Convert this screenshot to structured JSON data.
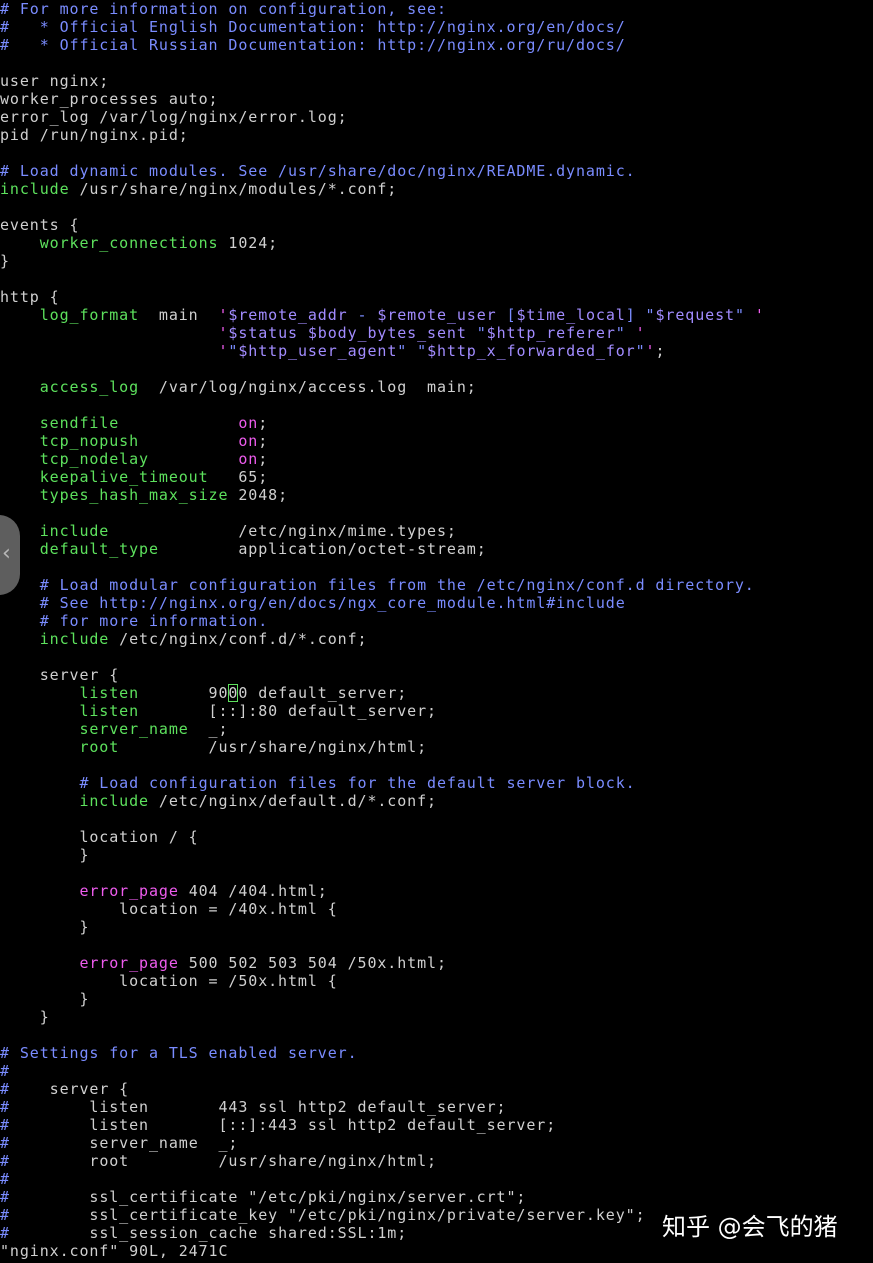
{
  "editor": {
    "lines": [
      [
        {
          "t": "# For more information on configuration, see:",
          "s": "comment"
        }
      ],
      [
        {
          "t": "#   * Official English Documentation: http://nginx.org/en/docs/",
          "s": "comment"
        }
      ],
      [
        {
          "t": "#   * Official Russian Documentation: http://nginx.org/ru/docs/",
          "s": "comment"
        }
      ],
      [],
      [
        {
          "t": "user nginx;",
          "s": "plain"
        }
      ],
      [
        {
          "t": "worker_processes auto;",
          "s": "plain"
        }
      ],
      [
        {
          "t": "error_log /var/log/nginx/error.log;",
          "s": "plain"
        }
      ],
      [
        {
          "t": "pid /run/nginx.pid;",
          "s": "plain"
        }
      ],
      [],
      [
        {
          "t": "# Load dynamic modules. See /usr/share/doc/nginx/README.dynamic.",
          "s": "comment"
        }
      ],
      [
        {
          "t": "include",
          "s": "keyword"
        },
        {
          "t": " /usr/share/nginx/modules/*.conf;",
          "s": "plain"
        }
      ],
      [],
      [
        {
          "t": "events {",
          "s": "plain"
        }
      ],
      [
        {
          "t": "    worker_connections",
          "s": "keyword"
        },
        {
          "t": " 1024;",
          "s": "plain"
        }
      ],
      [
        {
          "t": "}",
          "s": "plain"
        }
      ],
      [],
      [
        {
          "t": "http {",
          "s": "plain"
        }
      ],
      [
        {
          "t": "    log_format",
          "s": "keyword"
        },
        {
          "t": "  main  ",
          "s": "plain"
        },
        {
          "t": "'",
          "s": "value"
        },
        {
          "t": "$remote_addr",
          "s": "var"
        },
        {
          "t": " - ",
          "s": "string"
        },
        {
          "t": "$remote_user",
          "s": "var"
        },
        {
          "t": " [",
          "s": "string"
        },
        {
          "t": "$time_local",
          "s": "var"
        },
        {
          "t": "] \"",
          "s": "string"
        },
        {
          "t": "$request",
          "s": "var"
        },
        {
          "t": "\" ",
          "s": "string"
        },
        {
          "t": "'",
          "s": "value"
        }
      ],
      [
        {
          "t": "                      ",
          "s": "plain"
        },
        {
          "t": "'",
          "s": "value"
        },
        {
          "t": "$status",
          "s": "var"
        },
        {
          "t": " ",
          "s": "string"
        },
        {
          "t": "$body_bytes_sent",
          "s": "var"
        },
        {
          "t": " \"",
          "s": "string"
        },
        {
          "t": "$http_referer",
          "s": "var"
        },
        {
          "t": "\" ",
          "s": "string"
        },
        {
          "t": "'",
          "s": "value"
        }
      ],
      [
        {
          "t": "                      ",
          "s": "plain"
        },
        {
          "t": "'",
          "s": "value"
        },
        {
          "t": "\"",
          "s": "string"
        },
        {
          "t": "$http_user_agent",
          "s": "var"
        },
        {
          "t": "\" \"",
          "s": "string"
        },
        {
          "t": "$http_x_forwarded_for",
          "s": "var"
        },
        {
          "t": "\"",
          "s": "string"
        },
        {
          "t": "'",
          "s": "value"
        },
        {
          "t": ";",
          "s": "plain"
        }
      ],
      [],
      [
        {
          "t": "    access_log",
          "s": "keyword"
        },
        {
          "t": "  /var/log/nginx/access.log  main;",
          "s": "plain"
        }
      ],
      [],
      [
        {
          "t": "    sendfile",
          "s": "keyword"
        },
        {
          "t": "            ",
          "s": "plain"
        },
        {
          "t": "on",
          "s": "value"
        },
        {
          "t": ";",
          "s": "plain"
        }
      ],
      [
        {
          "t": "    tcp_nopush",
          "s": "keyword"
        },
        {
          "t": "          ",
          "s": "plain"
        },
        {
          "t": "on",
          "s": "value"
        },
        {
          "t": ";",
          "s": "plain"
        }
      ],
      [
        {
          "t": "    tcp_nodelay",
          "s": "keyword"
        },
        {
          "t": "         ",
          "s": "plain"
        },
        {
          "t": "on",
          "s": "value"
        },
        {
          "t": ";",
          "s": "plain"
        }
      ],
      [
        {
          "t": "    keepalive_timeout",
          "s": "keyword"
        },
        {
          "t": "   65;",
          "s": "plain"
        }
      ],
      [
        {
          "t": "    types_hash_max_size",
          "s": "keyword"
        },
        {
          "t": " 2048;",
          "s": "plain"
        }
      ],
      [],
      [
        {
          "t": "    include",
          "s": "keyword"
        },
        {
          "t": "             /etc/nginx/mime.types;",
          "s": "plain"
        }
      ],
      [
        {
          "t": "    default_type",
          "s": "keyword"
        },
        {
          "t": "        application/octet-stream;",
          "s": "plain"
        }
      ],
      [],
      [
        {
          "t": "    # Load modular configuration files from the /etc/nginx/conf.d directory.",
          "s": "comment"
        }
      ],
      [
        {
          "t": "    # See http://nginx.org/en/docs/ngx_core_module.html#include",
          "s": "comment"
        }
      ],
      [
        {
          "t": "    # for more information.",
          "s": "comment"
        }
      ],
      [
        {
          "t": "    include",
          "s": "keyword"
        },
        {
          "t": " /etc/nginx/conf.d/*.conf;",
          "s": "plain"
        }
      ],
      [],
      [
        {
          "t": "    server {",
          "s": "plain"
        }
      ],
      [
        {
          "t": "        listen",
          "s": "keyword"
        },
        {
          "t": "       90",
          "s": "plain"
        },
        {
          "t": "0",
          "s": "plain",
          "cursor": true
        },
        {
          "t": "0 default_server;",
          "s": "plain"
        }
      ],
      [
        {
          "t": "        listen",
          "s": "keyword"
        },
        {
          "t": "       [::]:80 default_server;",
          "s": "plain"
        }
      ],
      [
        {
          "t": "        server_name",
          "s": "keyword"
        },
        {
          "t": "  _;",
          "s": "plain"
        }
      ],
      [
        {
          "t": "        root",
          "s": "keyword"
        },
        {
          "t": "         /usr/share/nginx/html;",
          "s": "plain"
        }
      ],
      [],
      [
        {
          "t": "        # Load configuration files for the default server block.",
          "s": "comment"
        }
      ],
      [
        {
          "t": "        include",
          "s": "keyword"
        },
        {
          "t": " /etc/nginx/default.d/*.conf;",
          "s": "plain"
        }
      ],
      [],
      [
        {
          "t": "        location / {",
          "s": "plain"
        }
      ],
      [
        {
          "t": "        }",
          "s": "plain"
        }
      ],
      [],
      [
        {
          "t": "        error_page",
          "s": "value"
        },
        {
          "t": " 404 /404.html;",
          "s": "plain"
        }
      ],
      [
        {
          "t": "            location = /40x.html {",
          "s": "plain"
        }
      ],
      [
        {
          "t": "        }",
          "s": "plain"
        }
      ],
      [],
      [
        {
          "t": "        error_page",
          "s": "value"
        },
        {
          "t": " 500 502 503 504 /50x.html;",
          "s": "plain"
        }
      ],
      [
        {
          "t": "            location = /50x.html {",
          "s": "plain"
        }
      ],
      [
        {
          "t": "        }",
          "s": "plain"
        }
      ],
      [
        {
          "t": "    }",
          "s": "plain"
        }
      ],
      [],
      [
        {
          "t": "# Settings for a TLS enabled server.",
          "s": "comment"
        }
      ],
      [
        {
          "t": "#",
          "s": "comment"
        }
      ],
      [
        {
          "t": "#",
          "s": "comment"
        },
        {
          "t": "    server {",
          "s": "plain"
        }
      ],
      [
        {
          "t": "#",
          "s": "comment"
        },
        {
          "t": "        listen       443 ssl http2 default_server;",
          "s": "plain"
        }
      ],
      [
        {
          "t": "#",
          "s": "comment"
        },
        {
          "t": "        listen       [::]:443 ssl http2 default_server;",
          "s": "plain"
        }
      ],
      [
        {
          "t": "#",
          "s": "comment"
        },
        {
          "t": "        server_name  _;",
          "s": "plain"
        }
      ],
      [
        {
          "t": "#",
          "s": "comment"
        },
        {
          "t": "        root         /usr/share/nginx/html;",
          "s": "plain"
        }
      ],
      [
        {
          "t": "#",
          "s": "comment"
        }
      ],
      [
        {
          "t": "#",
          "s": "comment"
        },
        {
          "t": "        ssl_certificate \"/etc/pki/nginx/server.crt\";",
          "s": "plain"
        }
      ],
      [
        {
          "t": "#",
          "s": "comment"
        },
        {
          "t": "        ssl_certificate_key \"/etc/pki/nginx/private/server.key\";",
          "s": "plain"
        }
      ],
      [
        {
          "t": "#",
          "s": "comment"
        },
        {
          "t": "        ssl_session_cache shared:SSL:1m;",
          "s": "plain"
        }
      ]
    ]
  },
  "status_bar": {
    "file_info": "\"nginx.conf\" 90L, 2471C"
  },
  "overlay": {
    "side_handle_icon": "chevron-left-icon",
    "side_handle_glyph": "‹",
    "watermark_text": "知乎 @会飞的猪"
  },
  "colors": {
    "background": "#000000",
    "plain_text": "#d0d0d0",
    "comment": "#7a8cff",
    "keyword": "#5de15d",
    "value": "#ee5cee"
  }
}
